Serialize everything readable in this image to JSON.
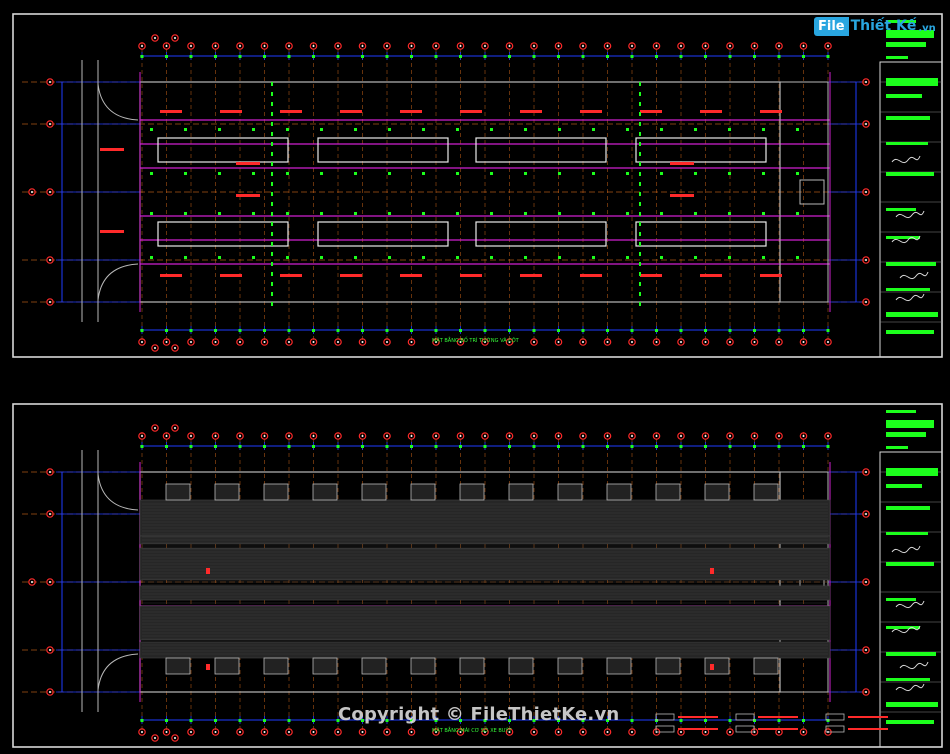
{
  "logo": {
    "part1": "File",
    "part2": "Thiết Kế",
    "part3": ".vn"
  },
  "watermark": "Copyright © FileThietKe.vn",
  "sheets": [
    {
      "caption": "MẶT BẰNG BỐ TRÍ TƯỜNG VÀ CỘT"
    },
    {
      "caption": "MẶT BẰNG MÁI CƠ SỞ XE BUÝT"
    }
  ],
  "colors": {
    "background": "#000000",
    "frame": "#d8d8d8",
    "grid_axis": "#ff7f1f",
    "column_marker": "#ff2a2a",
    "dimension": "#1e3cff",
    "wall": "#b9b9b9",
    "magenta": "#d020d0",
    "green": "#1cff1c",
    "roof_fill": "#2a2a2a",
    "logo_blue": "#29a6e0"
  }
}
